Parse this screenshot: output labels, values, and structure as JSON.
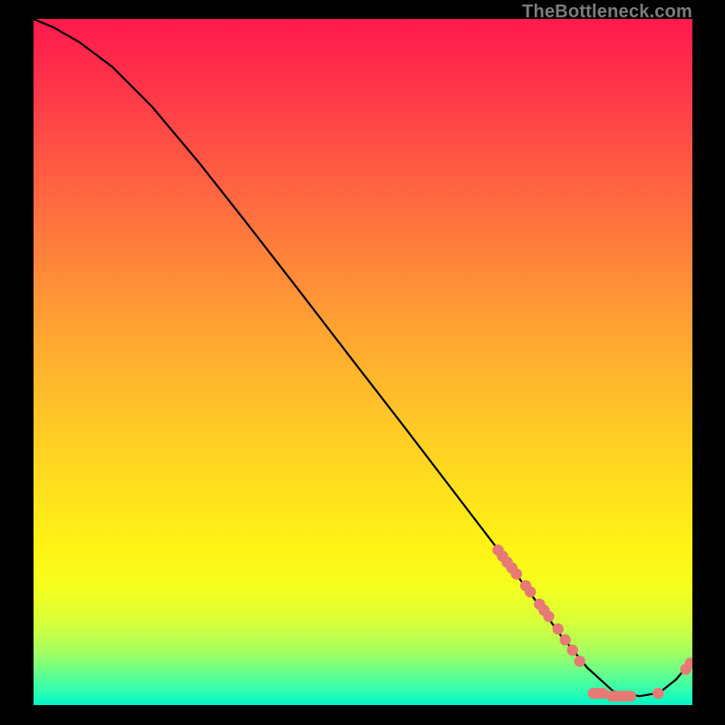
{
  "watermark": {
    "text": "TheBottleneck.com"
  },
  "colors": {
    "dot": "#e77a74",
    "curve": "#000000",
    "gradient_top": "#ff1a4d",
    "gradient_bottom": "#00f5c8"
  },
  "chart_data": {
    "type": "line",
    "title": "",
    "xlabel": "",
    "ylabel": "",
    "xlim": [
      0,
      100
    ],
    "ylim": [
      0,
      100
    ],
    "grid": false,
    "legend": false,
    "background_gradient": "red-yellow-green vertical",
    "series": [
      {
        "name": "curve",
        "x": [
          0,
          3,
          7,
          12,
          18,
          25,
          32,
          40,
          48,
          56,
          63,
          70,
          75,
          80,
          84,
          88,
          92,
          95,
          97.5,
          100
        ],
        "y": [
          100,
          98.8,
          96.6,
          93.0,
          87.2,
          79.2,
          70.7,
          60.8,
          50.8,
          40.9,
          32.1,
          23.3,
          16.8,
          10.2,
          5.5,
          2.0,
          1.3,
          1.8,
          3.7,
          6.5
        ]
      }
    ],
    "scatter_points": [
      {
        "x": 70.5,
        "y": 22.6
      },
      {
        "x": 71.2,
        "y": 21.7
      },
      {
        "x": 71.9,
        "y": 20.8
      },
      {
        "x": 72.6,
        "y": 20.0
      },
      {
        "x": 73.3,
        "y": 19.1
      },
      {
        "x": 74.7,
        "y": 17.4
      },
      {
        "x": 75.4,
        "y": 16.5
      },
      {
        "x": 76.8,
        "y": 14.7
      },
      {
        "x": 77.5,
        "y": 13.8
      },
      {
        "x": 78.2,
        "y": 12.9
      },
      {
        "x": 79.6,
        "y": 11.1
      },
      {
        "x": 80.7,
        "y": 9.5
      },
      {
        "x": 81.8,
        "y": 8.0
      },
      {
        "x": 82.9,
        "y": 6.4
      },
      {
        "x": 85.0,
        "y": 1.7
      },
      {
        "x": 85.7,
        "y": 1.7
      },
      {
        "x": 86.4,
        "y": 1.7
      },
      {
        "x": 87.8,
        "y": 1.3
      },
      {
        "x": 88.5,
        "y": 1.3
      },
      {
        "x": 89.2,
        "y": 1.3
      },
      {
        "x": 89.9,
        "y": 1.3
      },
      {
        "x": 90.6,
        "y": 1.3
      },
      {
        "x": 94.8,
        "y": 1.7
      },
      {
        "x": 99.0,
        "y": 5.2
      },
      {
        "x": 99.7,
        "y": 6.1
      }
    ]
  }
}
